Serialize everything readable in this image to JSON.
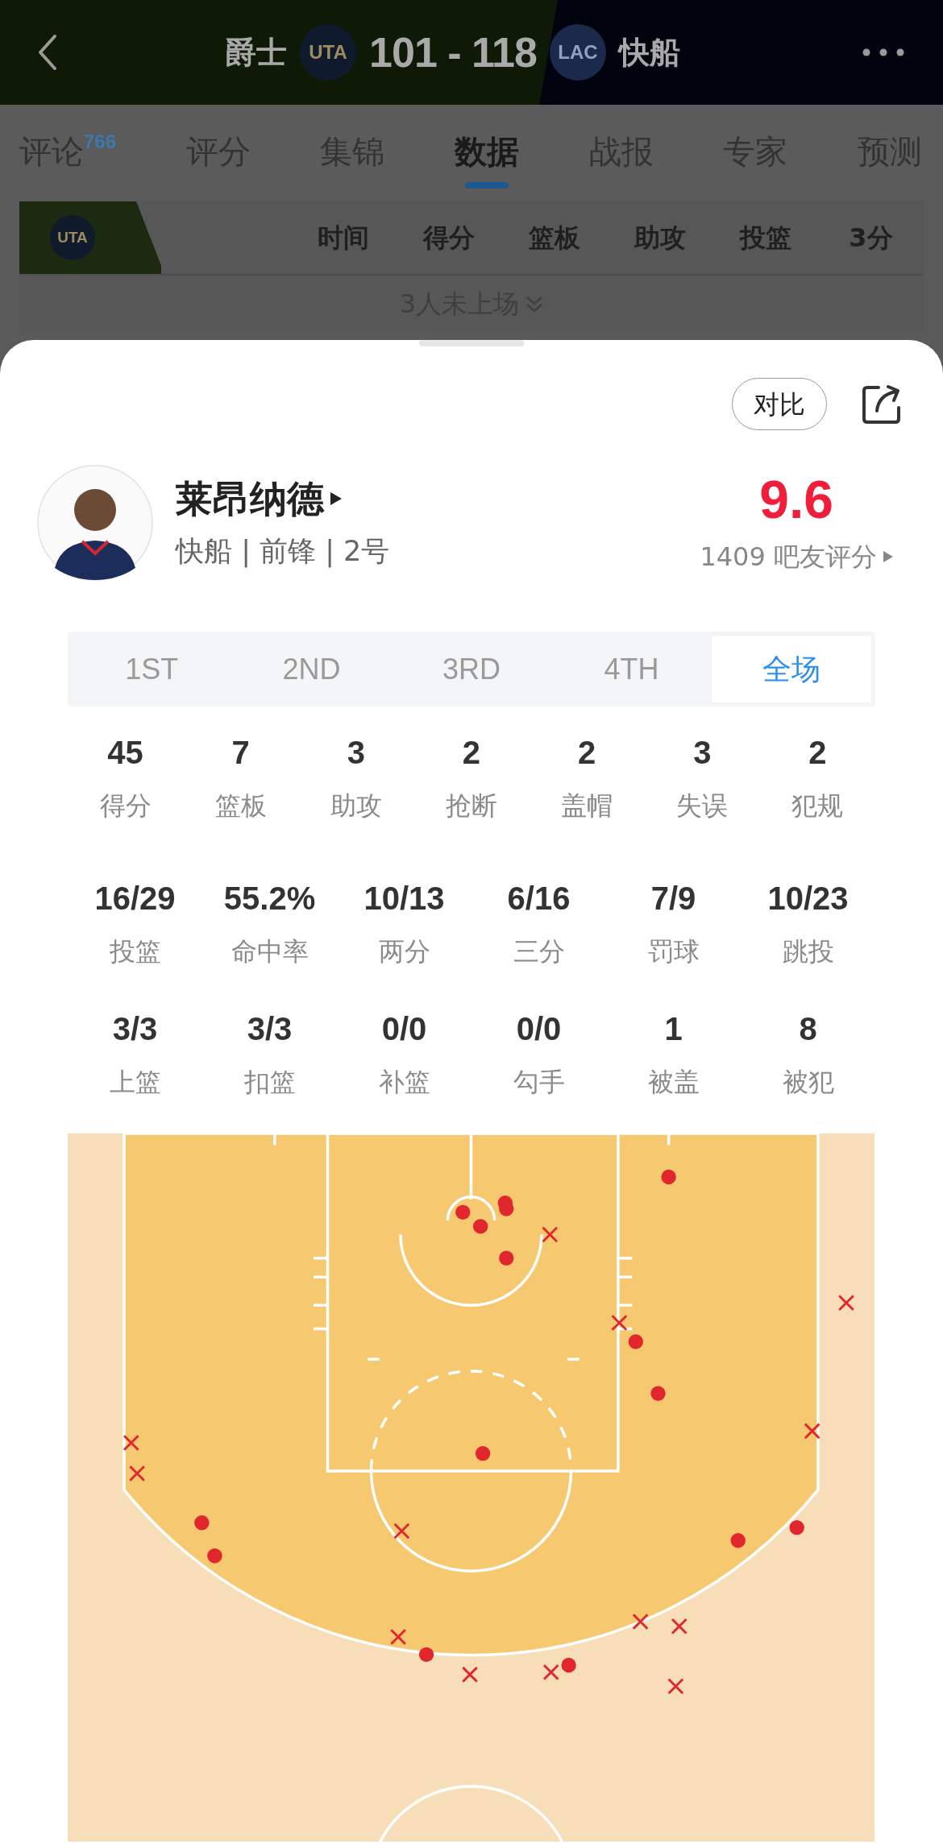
{
  "header": {
    "home_team": "爵士",
    "home_logo": "UTA",
    "score": "101 - 118",
    "away_logo": "LAC",
    "away_team": "快船"
  },
  "tabs": [
    {
      "label": "评论",
      "badge": "766",
      "selected": false
    },
    {
      "label": "评分",
      "selected": false
    },
    {
      "label": "集锦",
      "selected": false
    },
    {
      "label": "数据",
      "selected": true
    },
    {
      "label": "战报",
      "selected": false
    },
    {
      "label": "专家",
      "selected": false
    },
    {
      "label": "预测",
      "selected": false
    }
  ],
  "team_table": {
    "team_logo": "UTA",
    "columns": [
      "时间",
      "得分",
      "篮板",
      "助攻",
      "投篮",
      "3分"
    ]
  },
  "bench_note": "3人未上场",
  "player_sheet": {
    "compare_button": "对比",
    "name": "莱昂纳德",
    "info": "快船 | 前锋 | 2号",
    "rating": "9.6",
    "rating_count": "1409 吧友评分",
    "periods": [
      {
        "label": "1ST",
        "selected": false
      },
      {
        "label": "2ND",
        "selected": false
      },
      {
        "label": "3RD",
        "selected": false
      },
      {
        "label": "4TH",
        "selected": false
      },
      {
        "label": "全场",
        "selected": true
      }
    ],
    "main_stats": [
      {
        "value": "45",
        "label": "得分"
      },
      {
        "value": "7",
        "label": "篮板"
      },
      {
        "value": "3",
        "label": "助攻"
      },
      {
        "value": "2",
        "label": "抢断"
      },
      {
        "value": "2",
        "label": "盖帽"
      },
      {
        "value": "3",
        "label": "失误"
      },
      {
        "value": "2",
        "label": "犯规"
      }
    ],
    "shooting_stats": [
      {
        "value": "16/29",
        "label": "投篮"
      },
      {
        "value": "55.2%",
        "label": "命中率"
      },
      {
        "value": "10/13",
        "label": "两分"
      },
      {
        "value": "6/16",
        "label": "三分"
      },
      {
        "value": "7/9",
        "label": "罚球"
      },
      {
        "value": "10/23",
        "label": "跳投"
      }
    ],
    "shot_types": [
      {
        "value": "3/3",
        "label": "上篮"
      },
      {
        "value": "3/3",
        "label": "扣篮"
      },
      {
        "value": "0/0",
        "label": "补篮"
      },
      {
        "value": "0/0",
        "label": "勾手"
      },
      {
        "value": "1",
        "label": "被盖"
      },
      {
        "value": "8",
        "label": "被犯"
      }
    ]
  }
}
